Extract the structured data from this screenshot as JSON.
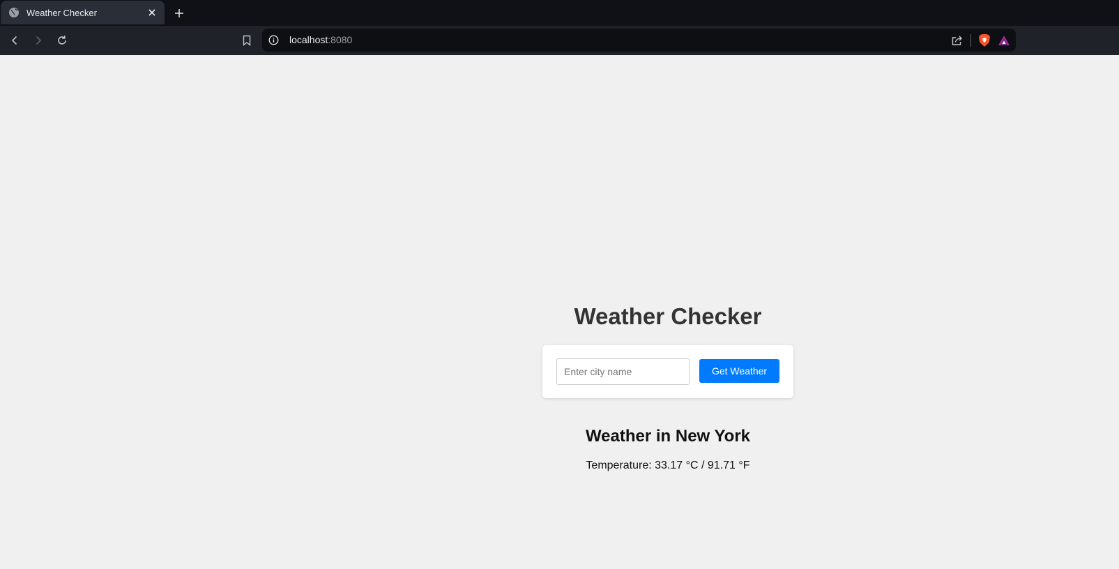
{
  "browser": {
    "tab": {
      "title": "Weather Checker"
    },
    "address_bar": {
      "host": "localhost",
      "port": ":8080"
    },
    "icons": [
      "globe-icon",
      "close-icon",
      "plus-icon",
      "back-icon",
      "forward-icon",
      "reload-icon",
      "bookmark-icon",
      "info-icon",
      "share-icon",
      "brave-shields-icon",
      "brave-rewards-icon"
    ]
  },
  "app": {
    "title": "Weather Checker",
    "search": {
      "placeholder": "Enter city name",
      "value": ""
    },
    "button_label": "Get Weather",
    "accent_color": "#007bff",
    "result": {
      "title": "Weather in New York",
      "temperature": "Temperature: 33.17 °C / 91.71 °F"
    }
  }
}
